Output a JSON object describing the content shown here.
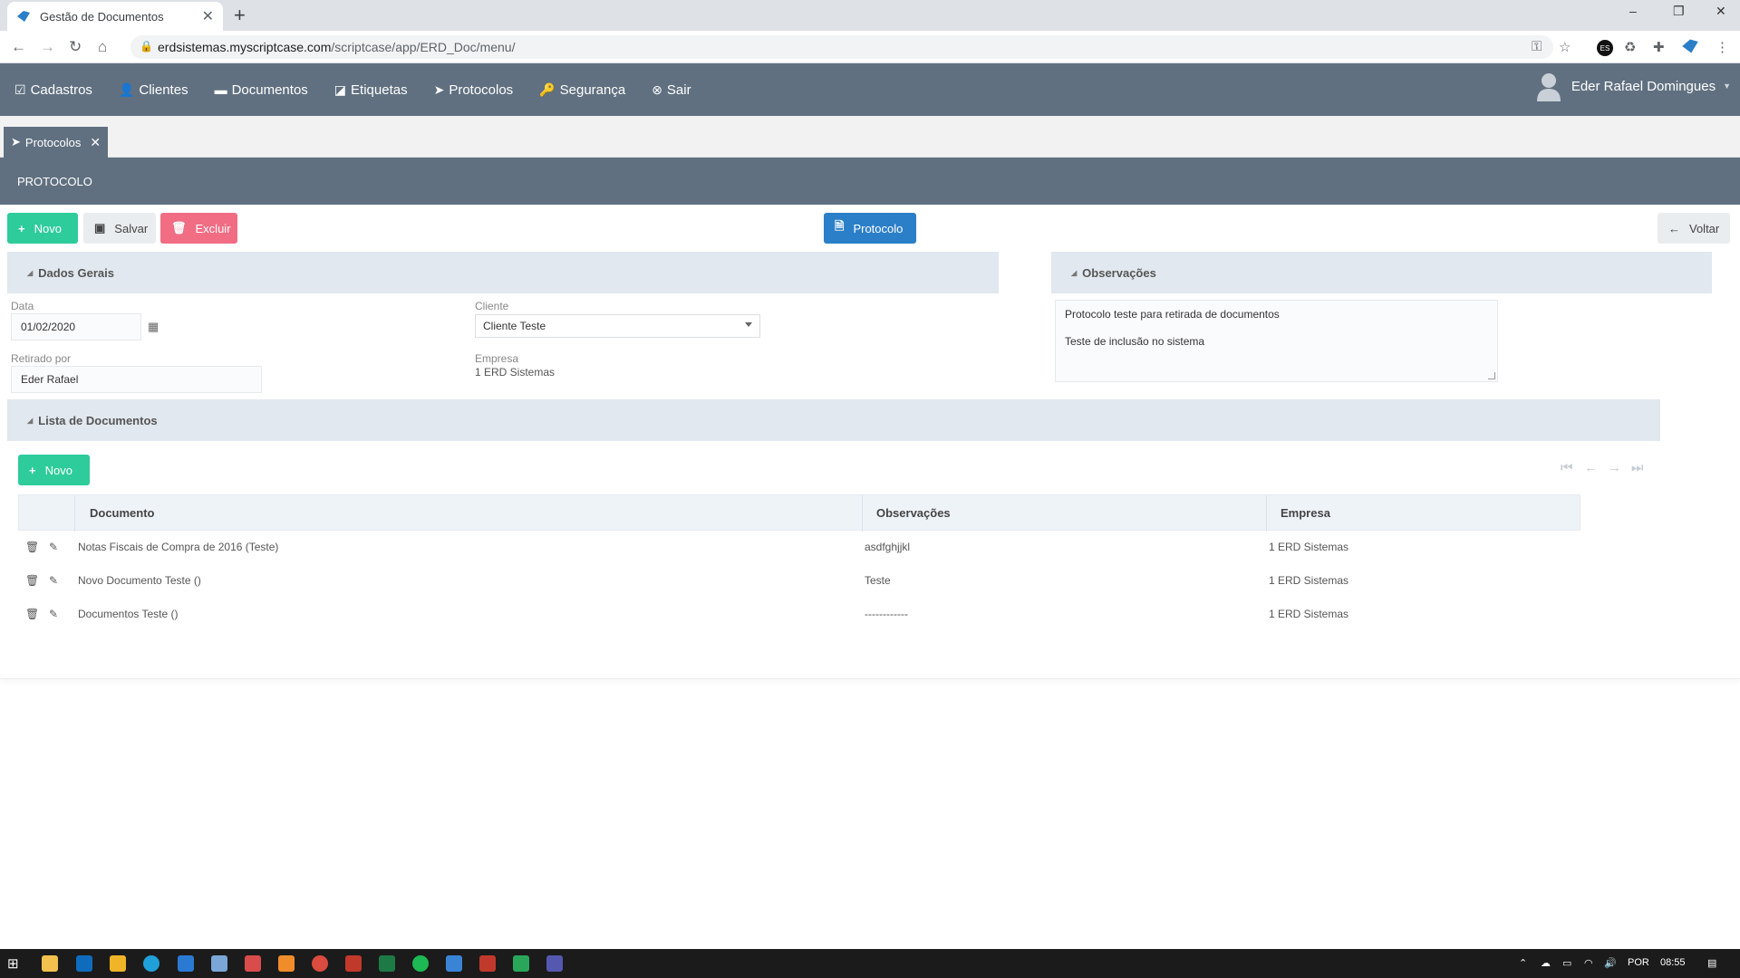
{
  "browser": {
    "tab_title": "Gestão de Documentos",
    "new_tab": "+",
    "url_host": "erdsistemas.myscriptcase.com",
    "url_path": "/scriptcase/app/ERD_Doc/menu/",
    "minimize": "–",
    "maximize": "❐",
    "close": "✕",
    "ext_es": "ES"
  },
  "nav": {
    "items": [
      {
        "label": "Cadastros",
        "icon": "edit-square-icon"
      },
      {
        "label": "Clientes",
        "icon": "user-icon"
      },
      {
        "label": "Documentos",
        "icon": "archive-icon"
      },
      {
        "label": "Etiquetas",
        "icon": "tag-icon"
      },
      {
        "label": "Protocolos",
        "icon": "paper-plane-icon"
      },
      {
        "label": "Segurança",
        "icon": "key-icon"
      },
      {
        "label": "Sair",
        "icon": "close-circle-icon"
      }
    ],
    "user_name": "Eder Rafael Domingues"
  },
  "app_tab": {
    "label": "Protocolos",
    "close": "✕"
  },
  "page_title": "PROTOCOLO",
  "toolbar": {
    "novo": "Novo",
    "salvar": "Salvar",
    "excluir": "Excluir",
    "protocolo": "Protocolo",
    "voltar": "Voltar"
  },
  "dados_gerais": {
    "title": "Dados Gerais",
    "data_label": "Data",
    "data_value": "01/02/2020",
    "cliente_label": "Cliente",
    "cliente_value": "Cliente Teste",
    "retirado_label": "Retirado por",
    "retirado_value": "Eder Rafael",
    "empresa_label": "Empresa",
    "empresa_value": "1 ERD Sistemas"
  },
  "observacoes": {
    "title": "Observações",
    "line1": "Protocolo teste para retirada de documentos",
    "line2": "Teste de inclusão no sistema"
  },
  "lista": {
    "title": "Lista de Documentos",
    "novo": "Novo",
    "columns": [
      "Documento",
      "Observações",
      "Empresa"
    ],
    "rows": [
      {
        "documento": "Notas Fiscais de Compra de 2016 (Teste)",
        "observacoes": "asdfghjjkl",
        "empresa": "1 ERD Sistemas"
      },
      {
        "documento": "Novo Documento Teste ()",
        "observacoes": "Teste",
        "empresa": "1 ERD Sistemas"
      },
      {
        "documento": "Documentos Teste ()",
        "observacoes": "------------",
        "empresa": "1 ERD Sistemas"
      }
    ]
  },
  "taskbar": {
    "lang": "POR",
    "time": "08:55"
  }
}
